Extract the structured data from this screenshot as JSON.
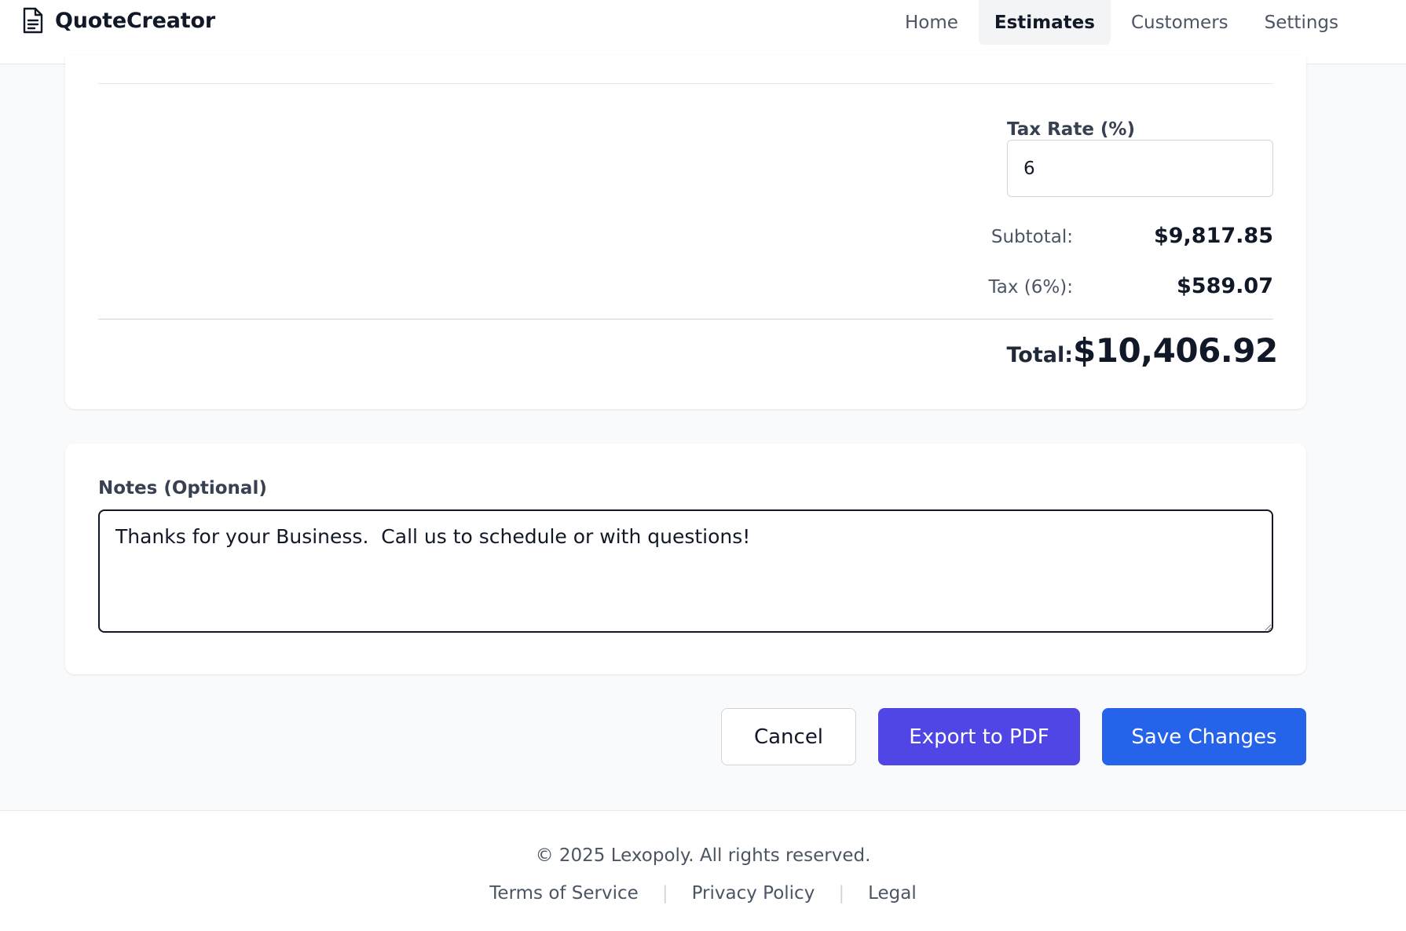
{
  "header": {
    "brand": "QuoteCreator",
    "brand_icon": "document-icon",
    "nav": [
      {
        "label": "Home",
        "active": false
      },
      {
        "label": "Estimates",
        "active": true
      },
      {
        "label": "Customers",
        "active": false
      },
      {
        "label": "Settings",
        "active": false
      }
    ]
  },
  "totals": {
    "tax_rate_label": "Tax Rate (%)",
    "tax_rate_value": "6",
    "subtotal_label": "Subtotal:",
    "subtotal_value": "$9,817.85",
    "tax_label": "Tax (6%):",
    "tax_value": "$589.07",
    "total_label": "Total:",
    "total_value": "$10,406.92"
  },
  "notes": {
    "label": "Notes (Optional)",
    "value": "Thanks for your Business.  Call us to schedule or with questions!"
  },
  "actions": {
    "cancel": "Cancel",
    "export": "Export to PDF",
    "save": "Save Changes"
  },
  "footer": {
    "copyright": "© 2025 Lexopoly. All rights reserved.",
    "links": [
      "Terms of Service",
      "Privacy Policy",
      "Legal"
    ],
    "separator": "|"
  },
  "colors": {
    "primary_blue": "#2563eb",
    "indigo": "#4f46e5",
    "background": "#f9fafb"
  }
}
